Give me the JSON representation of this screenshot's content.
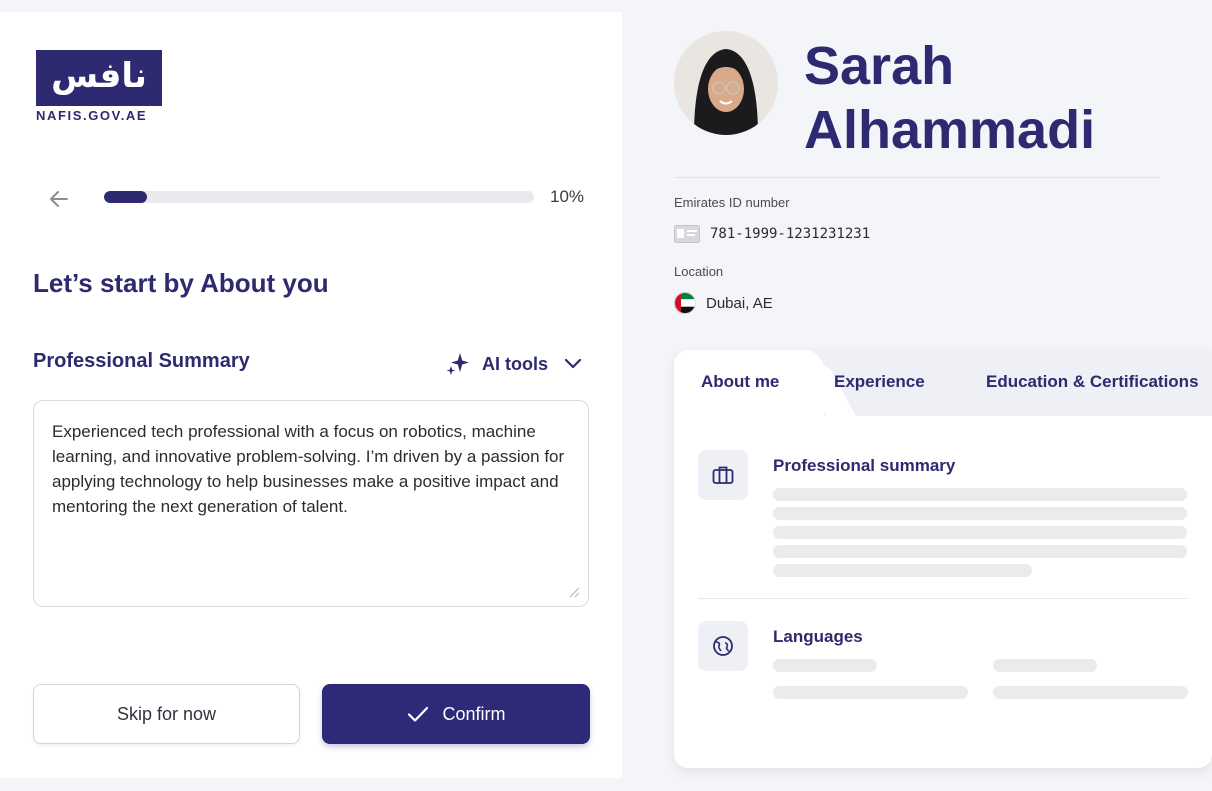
{
  "brand": {
    "logo_arabic": "نافس",
    "logo_text": "NAFIS.GOV.AE"
  },
  "progress": {
    "value_percent": 10,
    "label": "10%"
  },
  "form": {
    "title": "Let’s start by About you",
    "field_label": "Professional Summary",
    "ai_tools_label": "AI tools",
    "summary_text": "Experienced tech professional with a focus on robotics, machine learning, and innovative problem-solving. I’m driven by a passion for applying technology to help businesses make a positive impact and mentoring the next generation of talent."
  },
  "actions": {
    "skip_label": "Skip for now",
    "confirm_label": "Confirm"
  },
  "profile": {
    "first_name": "Sarah",
    "last_name": "Alhammadi",
    "emirates_id_label": "Emirates ID number",
    "emirates_id_value": "781-1999-1231231231",
    "location_label": "Location",
    "location_value": "Dubai, AE"
  },
  "tabs": [
    {
      "label": "About me",
      "active": true
    },
    {
      "label": "Experience",
      "active": false
    },
    {
      "label": "Education & Certifications",
      "active": false
    }
  ],
  "card_sections": {
    "summary_title": "Professional summary",
    "languages_title": "Languages"
  },
  "colors": {
    "brand": "#2e2a72",
    "accent": "#2e2a78",
    "background": "#f4f5f9"
  }
}
